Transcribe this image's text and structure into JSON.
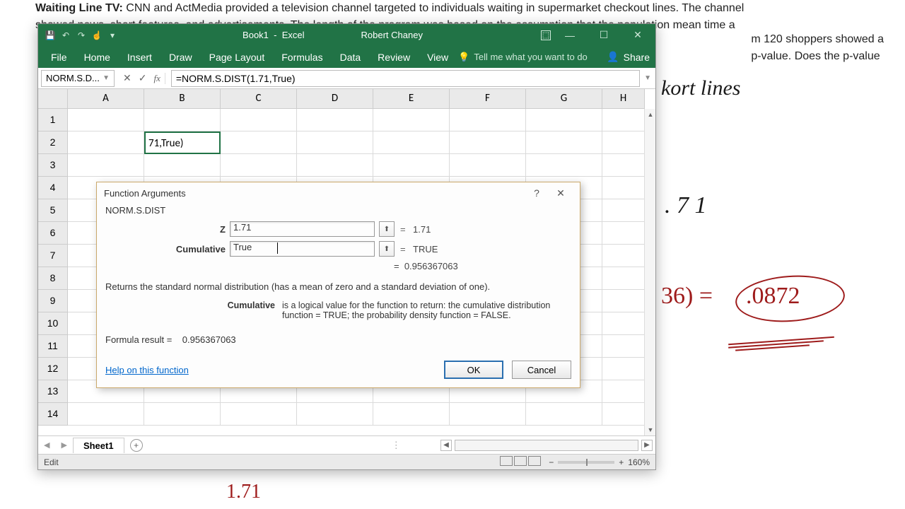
{
  "background": {
    "line1_bold": "Waiting Line TV:",
    "line1_rest": " CNN and ActMedia provided a television channel targeted to individuals waiting in supermarket checkout lines. The channel",
    "line2": "showed news, short features, and advertisements. The length of the program was based on the assumption that the population mean time a",
    "line3a": "m 120 shoppers showed a",
    "line3b": "p-value.  Does the p-value"
  },
  "window": {
    "book": "Book1",
    "app": "Excel",
    "user": "Robert Chaney",
    "tabs": {
      "file": "File",
      "home": "Home",
      "insert": "Insert",
      "draw": "Draw",
      "layout": "Page Layout",
      "formulas": "Formulas",
      "data": "Data",
      "review": "Review",
      "view": "View"
    },
    "tellme": "Tell me what you want to do",
    "share": "Share",
    "namebox": "NORM.S.D...",
    "formula": "=NORM.S.DIST(1.71,True)",
    "cell_b2": "71,True)",
    "columns": [
      "A",
      "B",
      "C",
      "D",
      "E",
      "F",
      "G",
      "H"
    ],
    "sheet": "Sheet1",
    "status": "Edit",
    "zoom": "160%"
  },
  "dialog": {
    "title": "Function Arguments",
    "fn": "NORM.S.DIST",
    "z_label": "Z",
    "z_val": "1.71",
    "z_eval": "1.71",
    "cum_label": "Cumulative",
    "cum_val": "True",
    "cum_eval": "TRUE",
    "result": "0.956367063",
    "desc": "Returns the standard normal distribution (has a mean of zero and a standard deviation of one).",
    "arg_name": "Cumulative",
    "arg_desc": "is a logical value for the function to return: the cumulative distribution function = TRUE; the probability density function = FALSE.",
    "formula_result_label": "Formula result =",
    "formula_result_val": "0.956367063",
    "help": "Help on this function",
    "ok": "OK",
    "cancel": "Cancel"
  },
  "hand": {
    "top": "kort lines",
    "mid": ". 7 1",
    "eq": "36) =",
    "val": ".0872",
    "bottom": "1.71"
  }
}
